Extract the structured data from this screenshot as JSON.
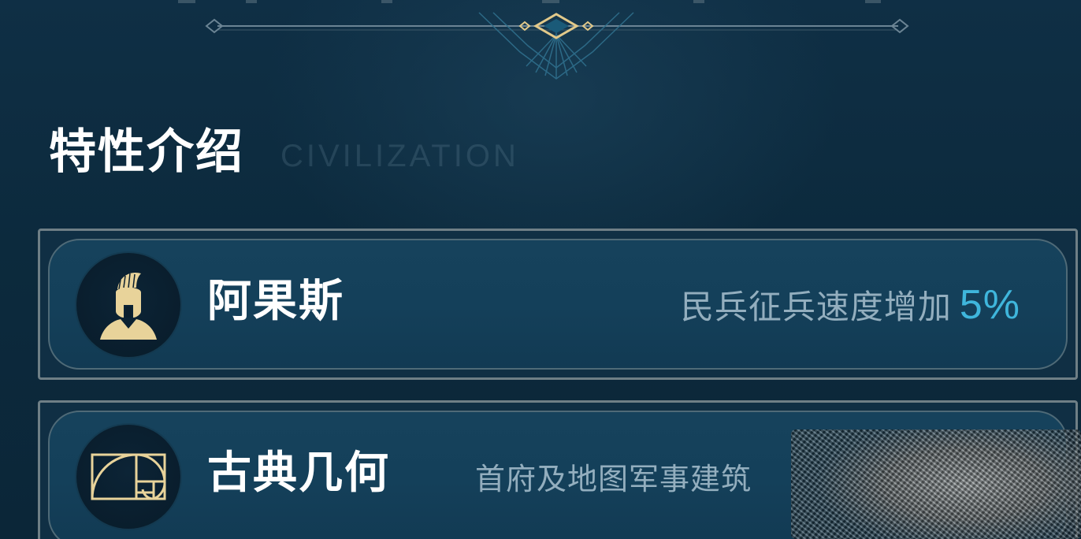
{
  "section": {
    "title": "特性介绍",
    "watermark": "CIVILIZATION"
  },
  "traits": [
    {
      "icon": "spartan-helmet-icon",
      "name": "阿果斯",
      "description": "民兵征兵速度增加",
      "value": "5%"
    },
    {
      "icon": "golden-ratio-icon",
      "name": "古典几何",
      "description": "首府及地图军事建筑"
    }
  ],
  "colors": {
    "background": "#0d2b3e",
    "card": "#14405a",
    "gold": "#e8d39a",
    "highlight": "#3fb6dc",
    "muted_text": "#93aebe"
  }
}
